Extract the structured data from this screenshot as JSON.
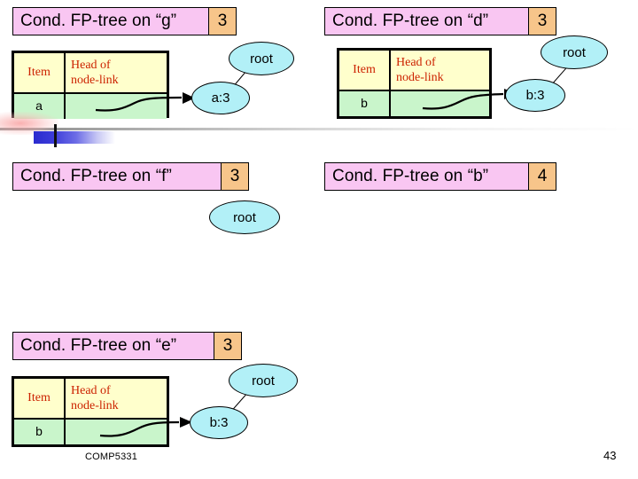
{
  "slide": {
    "footer": {
      "course": "COMP5331",
      "page_number": "43"
    },
    "colors": {
      "title_pink": "#f9c6f2",
      "count_orange": "#f7c58a",
      "table_header_yellow": "#ffffcc",
      "table_row_green": "#c9f5cb",
      "node_cyan": "#b2f0f7",
      "header_text_red": "#cc2200"
    }
  },
  "panels": [
    {
      "id": "g",
      "title": "Cond. FP-tree on “g”",
      "count": "3",
      "table": {
        "headers": [
          "Item",
          "Head of node-link"
        ],
        "header_item": "Item",
        "header_link_line1": "Head of",
        "header_link_line2": "node-link",
        "rows": [
          {
            "item": "a",
            "link": ""
          }
        ]
      },
      "tree": {
        "nodes": [
          {
            "label": "root"
          },
          {
            "label": "a:3"
          }
        ]
      }
    },
    {
      "id": "d",
      "title": "Cond. FP-tree on “d”",
      "count": "3",
      "table": {
        "headers": [
          "Item",
          "Head of node-link"
        ],
        "header_item": "Item",
        "header_link_line1": "Head of",
        "header_link_line2": "node-link",
        "rows": [
          {
            "item": "b",
            "link": ""
          }
        ]
      },
      "tree": {
        "nodes": [
          {
            "label": "root"
          },
          {
            "label": "b:3"
          }
        ]
      }
    },
    {
      "id": "f",
      "title": "Cond. FP-tree on “f”",
      "count": "3",
      "table": null,
      "tree": {
        "nodes": [
          {
            "label": "root"
          }
        ]
      }
    },
    {
      "id": "b",
      "title": "Cond. FP-tree on “b”",
      "count": "4",
      "table": null,
      "tree": {
        "nodes": []
      }
    },
    {
      "id": "e",
      "title": "Cond. FP-tree on “e”",
      "count": "3",
      "table": {
        "headers": [
          "Item",
          "Head of node-link"
        ],
        "header_item": "Item",
        "header_link_line1": "Head of",
        "header_link_line2": "node-link",
        "rows": [
          {
            "item": "b",
            "link": ""
          }
        ]
      },
      "tree": {
        "nodes": [
          {
            "label": "root"
          },
          {
            "label": "b:3"
          }
        ]
      }
    }
  ]
}
